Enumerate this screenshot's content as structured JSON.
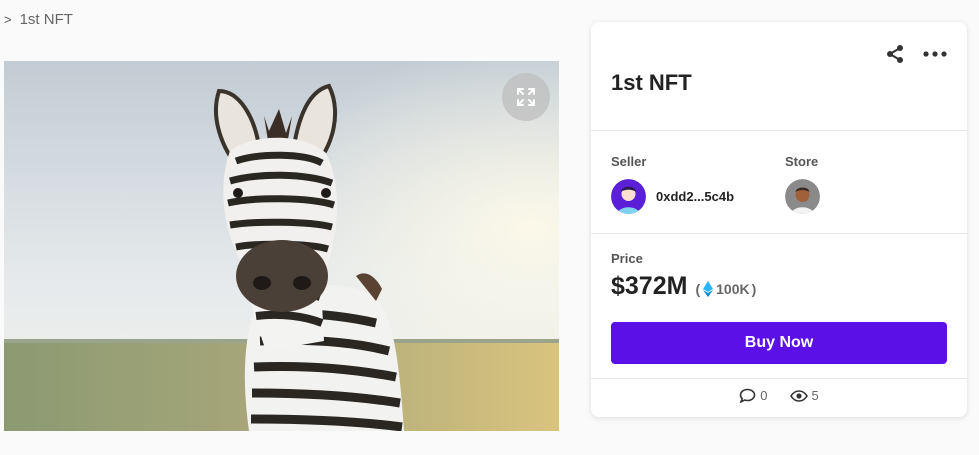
{
  "breadcrumb": {
    "separator": ">",
    "current": "1st NFT"
  },
  "artwork": {
    "image": "zebra-photo",
    "expand_icon": "expand-icon"
  },
  "item": {
    "title": "1st NFT"
  },
  "seller": {
    "label": "Seller",
    "address": "0xdd2...5c4b"
  },
  "store": {
    "label": "Store"
  },
  "price": {
    "label": "Price",
    "usd": "$372M",
    "paren_open": "(",
    "eth": "100K",
    "paren_close": ")"
  },
  "buy_button": {
    "label": "Buy Now"
  },
  "stats": {
    "comments": "0",
    "views": "5"
  },
  "colors": {
    "accent": "#5b10e8",
    "eth": "#29b6f6"
  }
}
